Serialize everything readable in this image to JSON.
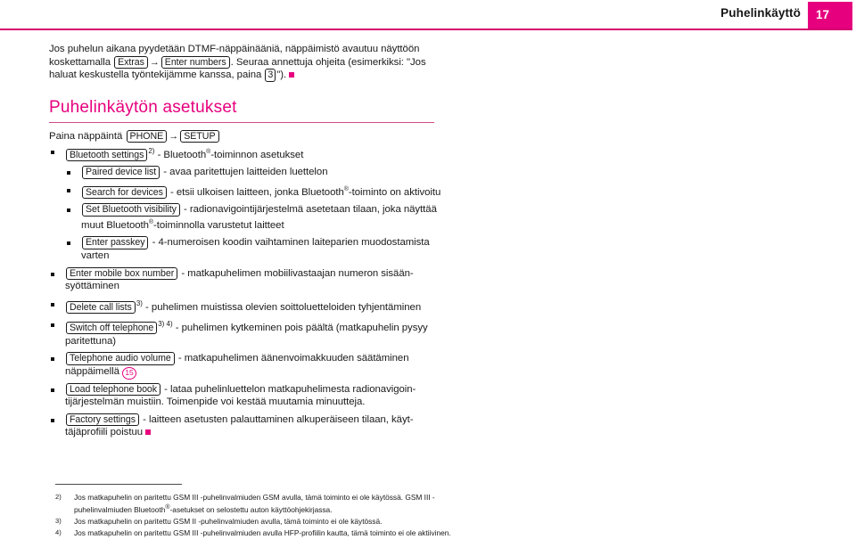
{
  "header": {
    "title": "Puhelinkäyttö",
    "page_number": "17",
    "accent_color": "#e6007e",
    "rule_color": "#d4006f"
  },
  "intro": {
    "text_part1": "Jos puhelun aikana pyydetään DTMF-näppäinääniä, näppäimistö avautuu näyttöön koskettamalla ",
    "key1": "Extras",
    "arrow": "→",
    "key2": "Enter numbers",
    "text_part2": ". Seuraa annettuja ohjeita (esimerkiksi: \"Jos haluat keskustella työntekijämme kanssa, paina ",
    "key3": "3",
    "text_part3": "\")."
  },
  "section": {
    "heading": "Puhelinkäytön asetukset",
    "press_label": "Paina näppäintä ",
    "press_key1": "PHONE",
    "press_arrow": "→",
    "press_key2": "SETUP"
  },
  "bullets": [
    {
      "level": 0,
      "key": "Bluetooth settings",
      "footnote": "2)",
      "desc_a": " - Bluetooth",
      "reg": "®",
      "desc_b": "-toiminnon asetukset"
    },
    {
      "level": 1,
      "key": "Paired device list",
      "footnote": "",
      "desc_a": " - avaa paritettujen laitteiden luettelon",
      "reg": "",
      "desc_b": ""
    },
    {
      "level": 1,
      "key": "Search for devices",
      "footnote": "",
      "desc_a": " - etsii ulkoisen laitteen, jonka Bluetooth",
      "reg": "®",
      "desc_b": "-toiminto on aktivoitu"
    },
    {
      "level": 1,
      "key": "Set Bluetooth visibility",
      "footnote": "",
      "desc_a": " - radionavigointijärjestelmä asetetaan tilaan, joka näyttää muut Bluetooth",
      "reg": "®",
      "desc_b": "-toiminnolla varustetut laitteet"
    },
    {
      "level": 1,
      "key": "Enter passkey",
      "footnote": "",
      "desc_a": " - 4-numeroisen koodin vaihtaminen laiteparien muodosta­mista varten",
      "reg": "",
      "desc_b": ""
    },
    {
      "level": 0,
      "key": "Enter mobile box number",
      "footnote": "",
      "desc_a": " - matkapuhelimen mobiilivastaajan numeron sisään­syöttäminen",
      "reg": "",
      "desc_b": ""
    },
    {
      "level": 0,
      "key": "Delete call lists",
      "footnote": "3)",
      "desc_a": " - puhelimen muistissa olevien soittoluetteloiden tyhjentä­minen",
      "reg": "",
      "desc_b": ""
    },
    {
      "level": 0,
      "key": "Switch off telephone",
      "footnote": "3) 4)",
      "desc_a": " - puhelimen kytkeminen pois päältä (matkapuhelin pysyy paritettuna)",
      "reg": "",
      "desc_b": ""
    },
    {
      "level": 0,
      "key": "Telephone audio volume",
      "footnote": "",
      "desc_a": " - matkapuhelimen äänenvoimakkuuden säätäminen näppäimellä ",
      "reg": "",
      "desc_b": "",
      "circle_ref": "15"
    },
    {
      "level": 0,
      "key": "Load telephone book",
      "footnote": "",
      "desc_a": " - lataa puhelinluettelon matkapuhelimesta radionavigoin­tijärjestelmän muistiin. Toimenpide voi kestää muutamia minuutteja.",
      "reg": "",
      "desc_b": ""
    },
    {
      "level": 0,
      "key": "Factory settings",
      "footnote": "",
      "desc_a": " - laitteen asetusten palauttaminen alkuperäiseen tilaan, käyt­täjäprofiili poistuu",
      "reg": "",
      "desc_b": "",
      "end_marker": true
    }
  ],
  "footnotes": [
    {
      "mark": "2)",
      "text_a": "Jos matkapuhelin on paritettu GSM III -puhelinvalmiuden GSM avulla, tämä toiminto ei ole käy­tössä. GSM III -puhelinvalmiuden Bluetooth",
      "reg": "®",
      "text_b": "-asetukset on selostettu auton käyttöohjekirjas­sa."
    },
    {
      "mark": "3)",
      "text_a": "Jos matkapuhelin on paritettu GSM II -puhelinvalmiuden avulla, tämä toiminto ei ole käytössä.",
      "reg": "",
      "text_b": ""
    },
    {
      "mark": "4)",
      "text_a": "Jos matkapuhelin on paritettu GSM III -puhelinvalmiuden avulla HFP-profiilin kautta, tämä toi­minto ei ole aktiivinen.",
      "reg": "",
      "text_b": ""
    }
  ]
}
